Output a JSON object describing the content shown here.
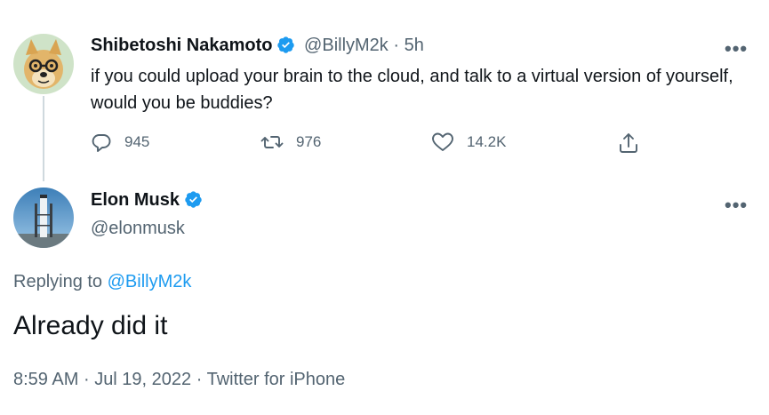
{
  "original_tweet": {
    "author_name": "Shibetoshi Nakamoto",
    "handle": "@BillyM2k",
    "separator": "·",
    "age": "5h",
    "text": "if you could upload your brain to the cloud, and talk to a virtual version of yourself, would you be buddies?",
    "more_label": "•••",
    "actions": {
      "replies": "945",
      "retweets": "976",
      "likes": "14.2K"
    }
  },
  "reply_tweet": {
    "author_name": "Elon Musk",
    "handle": "@elonmusk",
    "more_label": "•••",
    "replying_prefix": "Replying to",
    "replying_handle": "@BillyM2k",
    "text": "Already did it",
    "time": "8:59 AM",
    "date": "Jul 19, 2022",
    "source": "Twitter for iPhone",
    "separator": "·"
  },
  "colors": {
    "accent": "#1d9bf0",
    "text_primary": "#0f1419",
    "text_secondary": "#536471",
    "thread_line": "#cfd9de"
  },
  "icons": {
    "verified": "verified-badge-icon",
    "reply": "reply-icon",
    "retweet": "retweet-icon",
    "like": "heart-icon",
    "share": "share-icon",
    "more": "more-icon"
  }
}
